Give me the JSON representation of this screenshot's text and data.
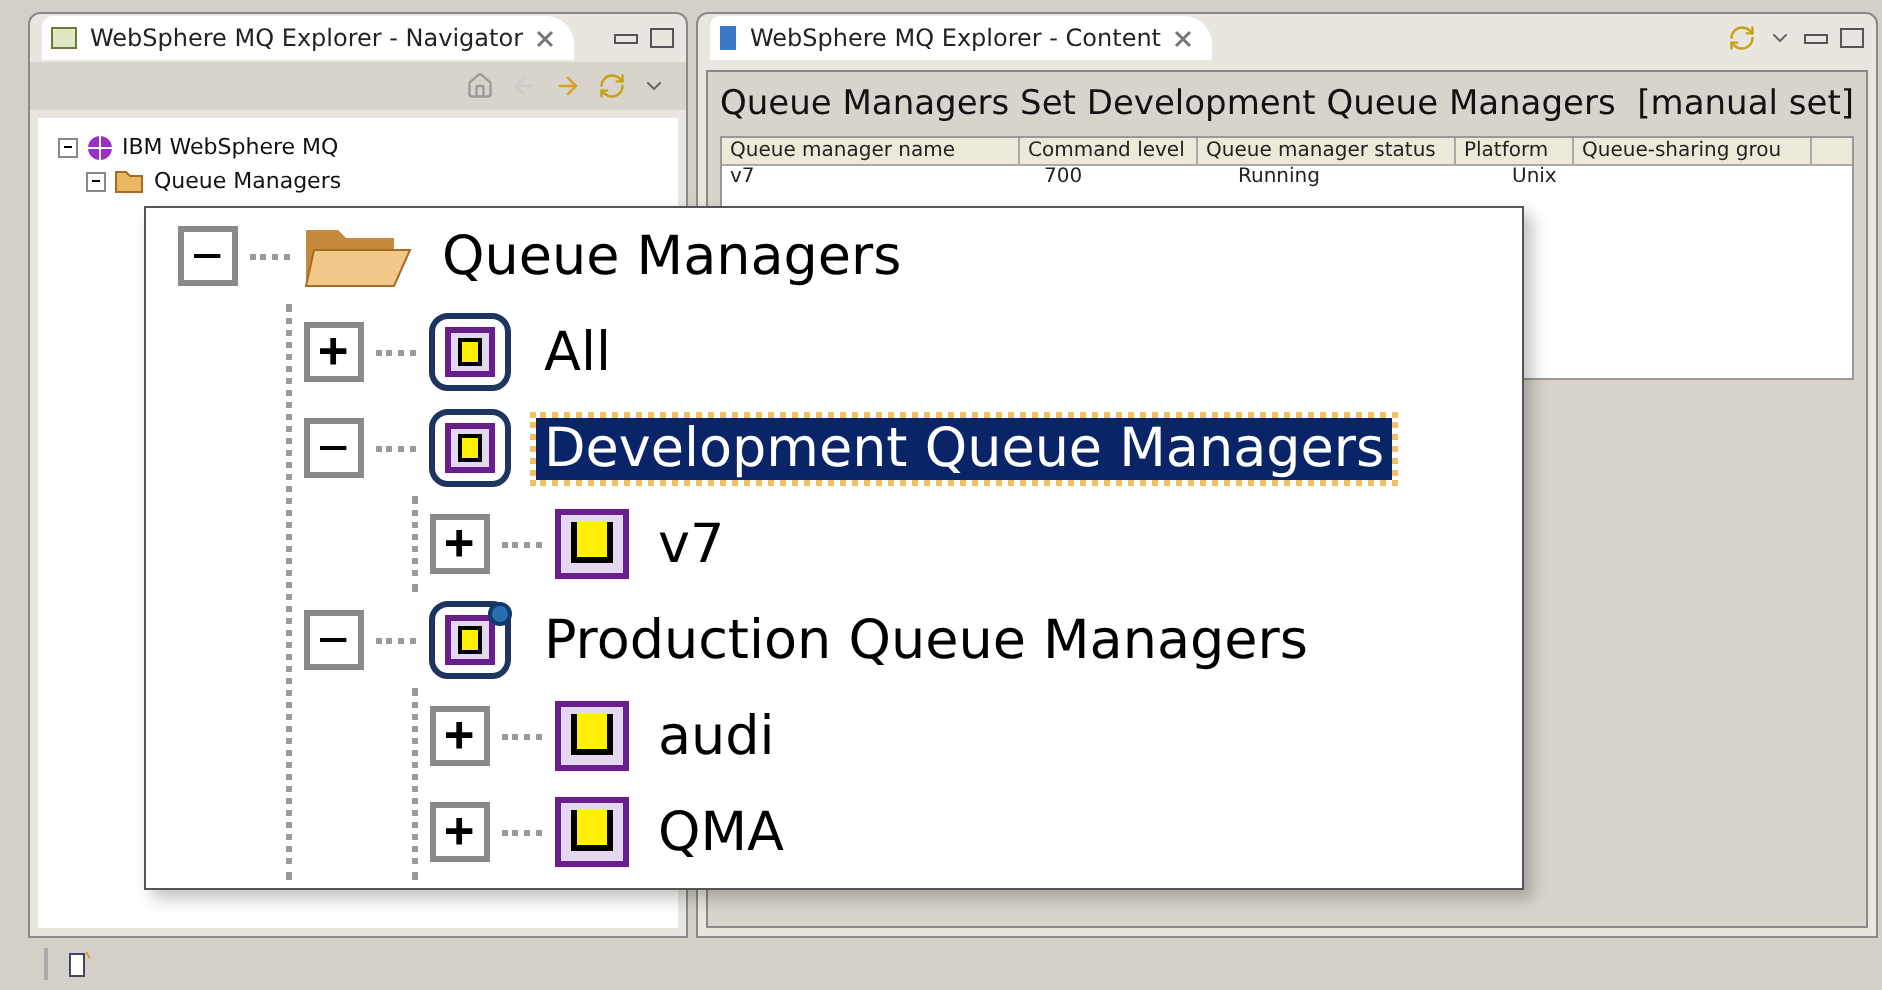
{
  "navigator": {
    "title": "WebSphere MQ Explorer - Navigator",
    "tree": [
      {
        "label": "IBM WebSphere MQ",
        "kind": "root",
        "expanded": true,
        "children": [
          {
            "label": "Queue Managers",
            "kind": "folder",
            "expanded": true
          }
        ]
      }
    ]
  },
  "content": {
    "title": "WebSphere MQ Explorer - Content",
    "heading": "Queue Managers Set Development Queue Managers",
    "set_type": "[manual set]",
    "table": {
      "columns": [
        "Queue manager name",
        "Command level",
        "Queue manager status",
        "Platform",
        "Queue-sharing grou"
      ],
      "rows": [
        [
          "v7",
          "700",
          "Running",
          "Unix"
        ]
      ]
    }
  },
  "callout": {
    "tree": [
      {
        "label": "Queue Managers",
        "kind": "folder",
        "expanded": true,
        "selected": false,
        "children": [
          {
            "label": "All",
            "kind": "set",
            "expanded": false,
            "selected": false
          },
          {
            "label": "Development Queue Managers",
            "kind": "set",
            "expanded": true,
            "selected": true,
            "children": [
              {
                "label": "v7",
                "kind": "qmgr",
                "expanded": false,
                "selected": false
              }
            ]
          },
          {
            "label": "Production Queue Managers",
            "kind": "autoset",
            "expanded": true,
            "selected": false,
            "children": [
              {
                "label": "audi",
                "kind": "qmgr",
                "expanded": false,
                "selected": false
              },
              {
                "label": "QMA",
                "kind": "qmgr",
                "expanded": false,
                "selected": false
              }
            ]
          }
        ]
      }
    ]
  }
}
